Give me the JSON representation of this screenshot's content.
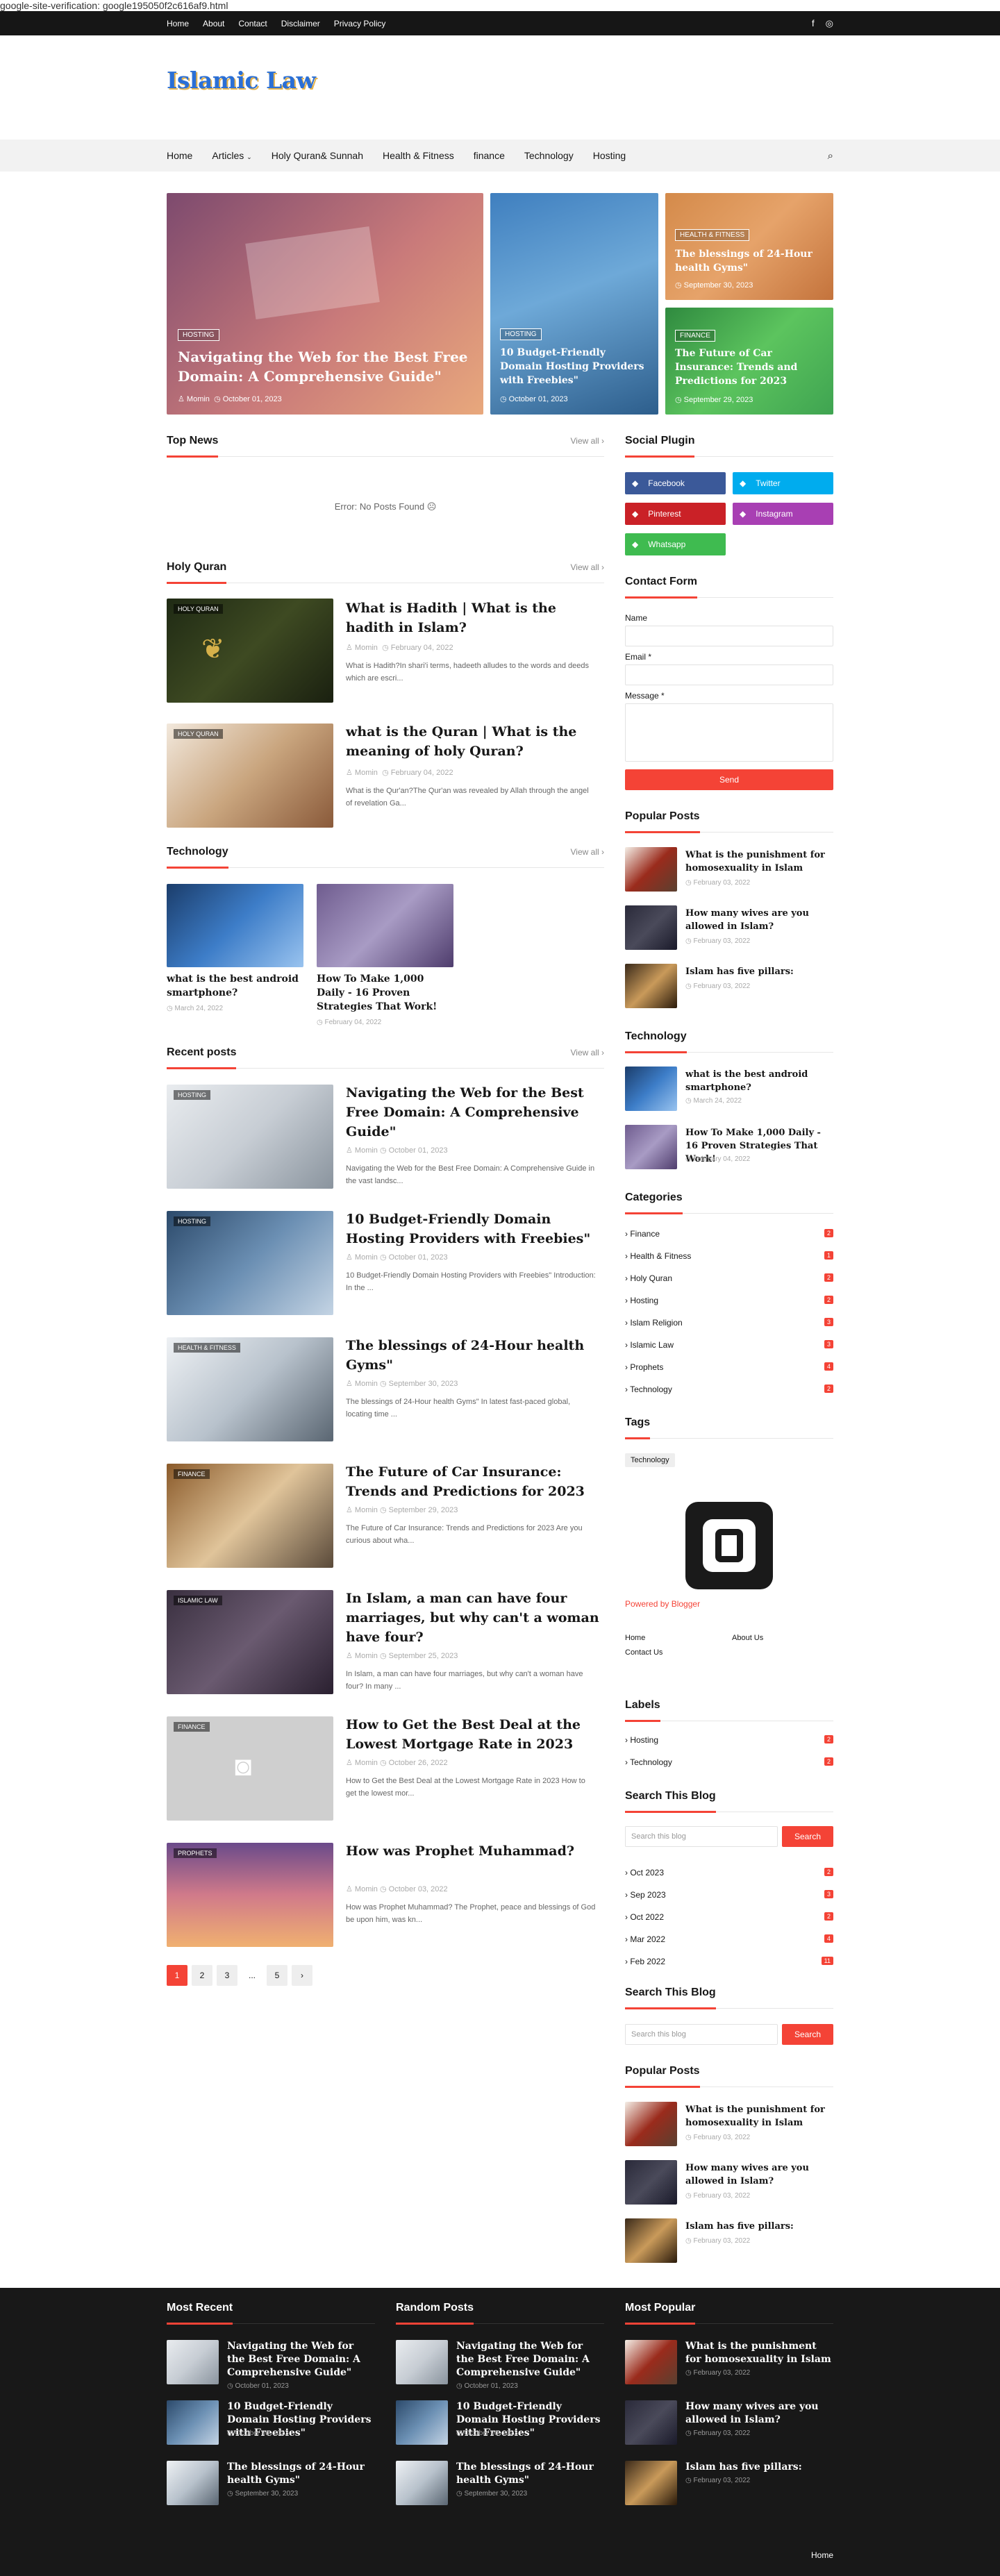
{
  "verification": "google-site-verification: google195050f2c616af9.html",
  "topbar": {
    "links": [
      "Home",
      "About",
      "Contact",
      "Disclaimer",
      "Privacy Policy"
    ]
  },
  "logo": "Islamic Law",
  "nav": {
    "items": [
      "Home",
      "Articles",
      "Holy Quran& Sunnah",
      "Health & Fitness",
      "finance",
      "Technology",
      "Hosting"
    ]
  },
  "featured": [
    {
      "tag": "HOSTING",
      "title": "Navigating the Web for the Best Free Domain: A Comprehensive Guide\"",
      "author": "Momin",
      "date": "October 01, 2023"
    },
    {
      "tag": "HOSTING",
      "title": "10 Budget-Friendly Domain Hosting Providers with Freebies\"",
      "date": "October 01, 2023"
    },
    {
      "tag": "HEALTH & FITNESS",
      "title": "The blessings of 24-Hour health Gyms\"",
      "date": "September 30, 2023"
    },
    {
      "tag": "FINANCE",
      "title": "The Future of Car Insurance: Trends and Predictions for 2023",
      "date": "September 29, 2023"
    }
  ],
  "top_news": {
    "title": "Top News",
    "view_all": "View all",
    "error": "Error: No Posts Found"
  },
  "holy_quran": {
    "title": "Holy Quran",
    "view_all": "View all",
    "posts": [
      {
        "label": "HOLY QURAN",
        "title": "What is Hadith | What is the hadith in Islam?",
        "author": "Momin",
        "date": "February 04, 2022",
        "excerpt": "What is Hadith?In shari'i terms, hadeeth alludes to the words and deeds which are escri..."
      },
      {
        "label": "HOLY QURAN",
        "title": "what is the Quran | What is the meaning of holy Quran?",
        "author": "Momin",
        "date": "February 04, 2022",
        "excerpt": "What is the Qur'an?The Qur'an was revealed by Allah through the angel of revelation Ga..."
      }
    ]
  },
  "technology": {
    "title": "Technology",
    "view_all": "View all",
    "posts": [
      {
        "title": "what is the best android smartphone?",
        "date": "March 24, 2022"
      },
      {
        "title": "How To Make 1,000 Daily - 16 Proven Strategies That Work!",
        "date": "February 04, 2022"
      }
    ]
  },
  "recent": {
    "title": "Recent posts",
    "view_all": "View all",
    "posts": [
      {
        "label": "HOSTING",
        "title": "Navigating the Web for the Best Free Domain: A Comprehensive Guide\"",
        "author": "Momin",
        "date": "October 01, 2023",
        "excerpt": "Navigating the Web for the Best Free Domain: A Comprehensive Guide in the vast landsc..."
      },
      {
        "label": "HOSTING",
        "title": "10 Budget-Friendly Domain Hosting Providers with Freebies\"",
        "author": "Momin",
        "date": "October 01, 2023",
        "excerpt": "10 Budget-Friendly Domain Hosting Providers with Freebies\" Introduction: In the ..."
      },
      {
        "label": "HEALTH & FITNESS",
        "title": "The blessings of 24-Hour health Gyms\"",
        "author": "Momin",
        "date": "September 30, 2023",
        "excerpt": "The blessings of 24-Hour health Gyms\" In latest fast-paced global, locating time ..."
      },
      {
        "label": "FINANCE",
        "title": "The Future of Car Insurance: Trends and Predictions for 2023",
        "author": "Momin",
        "date": "September 29, 2023",
        "excerpt": "The Future of Car Insurance: Trends and Predictions for 2023 Are you curious about wha..."
      },
      {
        "label": "ISLAMIC LAW",
        "title": "In Islam, a man can have four marriages, but why can't a woman have four?",
        "author": "Momin",
        "date": "September 25, 2023",
        "excerpt": "In Islam, a man can have four marriages, but why can't a woman have four? In many ..."
      },
      {
        "label": "FINANCE",
        "title": "How to Get the Best Deal at the Lowest Mortgage Rate in 2023",
        "author": "Momin",
        "date": "October 26, 2022",
        "excerpt": "How to Get the Best Deal at the Lowest Mortgage Rate in 2023 How to get the lowest mor..."
      },
      {
        "label": "PROPHETS",
        "title": "How was Prophet Muhammad?",
        "author": "Momin",
        "date": "October 03, 2022",
        "excerpt": "How was Prophet Muhammad? The Prophet, peace and blessings of God be upon him, was kn..."
      }
    ]
  },
  "pagination": [
    "1",
    "2",
    "3",
    "...",
    "5",
    "›"
  ],
  "social": {
    "title": "Social Plugin",
    "items": [
      {
        "label": "Facebook",
        "color": "#3b5999"
      },
      {
        "label": "Twitter",
        "color": "#00acee"
      },
      {
        "label": "Pinterest",
        "color": "#ca2127"
      },
      {
        "label": "Instagram",
        "color": "#a83fb3"
      },
      {
        "label": "Whatsapp",
        "color": "#3fbb50"
      }
    ]
  },
  "contact": {
    "title": "Contact Form",
    "name": "Name",
    "email": "Email *",
    "message": "Message *",
    "send": "Send"
  },
  "popular": {
    "title": "Popular Posts",
    "posts": [
      {
        "title": "What is the punishment for homosexuality in Islam",
        "date": "February 03, 2022"
      },
      {
        "title": "How many wives are you allowed in Islam?",
        "date": "February 03, 2022"
      },
      {
        "title": "Islam has five pillars:",
        "date": "February 03, 2022"
      }
    ]
  },
  "side_tech": {
    "title": "Technology",
    "posts": [
      {
        "title": "what is the best android smartphone?",
        "date": "March 24, 2022"
      },
      {
        "title": "How To Make 1,000 Daily - 16 Proven Strategies That Work!",
        "date": "February 04, 2022"
      }
    ]
  },
  "categories": {
    "title": "Categories",
    "items": [
      {
        "name": "Finance",
        "count": "2"
      },
      {
        "name": "Health & Fitness",
        "count": "1"
      },
      {
        "name": "Holy Quran",
        "count": "2"
      },
      {
        "name": "Hosting",
        "count": "2"
      },
      {
        "name": "Islam Religion",
        "count": "3"
      },
      {
        "name": "Islamic Law",
        "count": "3"
      },
      {
        "name": "Prophets",
        "count": "4"
      },
      {
        "name": "Technology",
        "count": "2"
      }
    ]
  },
  "tags": {
    "title": "Tags",
    "items": [
      "Technology"
    ]
  },
  "blogger": {
    "powered": "Powered by Blogger",
    "links": [
      "Home",
      "About Us",
      "Contact Us"
    ]
  },
  "labels": {
    "title": "Labels",
    "items": [
      {
        "name": "Hosting",
        "count": "2"
      },
      {
        "name": "Technology",
        "count": "2"
      }
    ]
  },
  "search1": {
    "title": "Search This Blog",
    "placeholder": "Search this blog",
    "button": "Search"
  },
  "archive": [
    {
      "name": "Oct 2023",
      "count": "2"
    },
    {
      "name": "Sep 2023",
      "count": "3"
    },
    {
      "name": "Oct 2022",
      "count": "2"
    },
    {
      "name": "Mar 2022",
      "count": "4"
    },
    {
      "name": "Feb 2022",
      "count": "11"
    }
  ],
  "search2": {
    "title": "Search This Blog",
    "placeholder": "Search this blog",
    "button": "Search"
  },
  "popular2": {
    "title": "Popular Posts",
    "posts": [
      {
        "title": "What is the punishment for homosexuality in Islam",
        "date": "February 03, 2022"
      },
      {
        "title": "How many wives are you allowed in Islam?",
        "date": "February 03, 2022"
      },
      {
        "title": "Islam has five pillars:",
        "date": "February 03, 2022"
      }
    ]
  },
  "footer": {
    "most_recent": {
      "title": "Most Recent",
      "posts": [
        {
          "title": "Navigating the Web for the Best Free Domain: A Comprehensive Guide\"",
          "date": "October 01, 2023"
        },
        {
          "title": "10 Budget-Friendly Domain Hosting Providers with Freebies\"",
          "date": "October 01, 2023"
        },
        {
          "title": "The blessings of 24-Hour health Gyms\"",
          "date": "September 30, 2023"
        }
      ]
    },
    "random": {
      "title": "Random Posts",
      "posts": [
        {
          "title": "Navigating the Web for the Best Free Domain: A Comprehensive Guide\"",
          "date": "October 01, 2023"
        },
        {
          "title": "10 Budget-Friendly Domain Hosting Providers with Freebies\"",
          "date": "October 01, 2023"
        },
        {
          "title": "The blessings of 24-Hour health Gyms\"",
          "date": "September 30, 2023"
        }
      ]
    },
    "most_popular": {
      "title": "Most Popular",
      "posts": [
        {
          "title": "What is the punishment for homosexuality in Islam",
          "date": "February 03, 2022"
        },
        {
          "title": "How many wives are you allowed in Islam?",
          "date": "February 03, 2022"
        },
        {
          "title": "Islam has five pillars:",
          "date": "February 03, 2022"
        }
      ]
    },
    "home": "Home"
  }
}
